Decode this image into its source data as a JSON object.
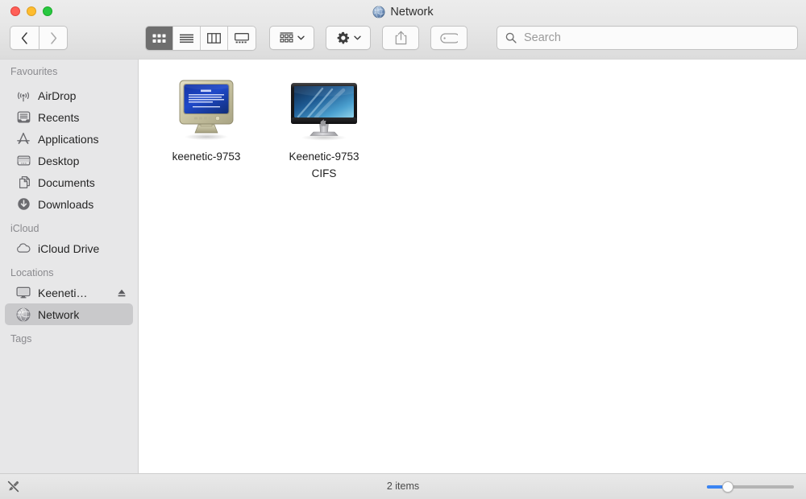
{
  "window": {
    "title": "Network",
    "title_icon": "globe-icon",
    "traffic_lights": [
      {
        "name": "close",
        "color": "#ff5f57"
      },
      {
        "name": "minimise",
        "color": "#febc2e"
      },
      {
        "name": "zoom",
        "color": "#28c840"
      }
    ]
  },
  "toolbar": {
    "back_icon": "chevron-left-icon",
    "forward_icon": "chevron-right-icon",
    "view_modes": [
      {
        "name": "icon-view",
        "icon": "grid-icon",
        "active": true
      },
      {
        "name": "list-view",
        "icon": "list-icon",
        "active": false
      },
      {
        "name": "column-view",
        "icon": "columns-icon",
        "active": false
      },
      {
        "name": "gallery-view",
        "icon": "gallery-icon",
        "active": false
      }
    ],
    "group_by": {
      "name": "group-by-button",
      "icon": "group-icon",
      "caret": "chevron-down-icon"
    },
    "action": {
      "name": "action-button",
      "icon": "gear-icon",
      "caret": "chevron-down-icon"
    },
    "share": {
      "name": "share-button",
      "icon": "share-icon"
    },
    "tag": {
      "name": "tag-button",
      "icon": "tag-icon"
    }
  },
  "search": {
    "placeholder": "Search",
    "value": "",
    "icon": "search-icon"
  },
  "sidebar": {
    "sections": [
      {
        "label": "Favourites",
        "items": [
          {
            "label": "AirDrop",
            "icon": "airdrop-icon",
            "selected": false
          },
          {
            "label": "Recents",
            "icon": "recents-icon",
            "selected": false
          },
          {
            "label": "Applications",
            "icon": "applications-icon",
            "selected": false
          },
          {
            "label": "Desktop",
            "icon": "desktop-icon",
            "selected": false
          },
          {
            "label": "Documents",
            "icon": "documents-icon",
            "selected": false
          },
          {
            "label": "Downloads",
            "icon": "downloads-icon",
            "selected": false
          }
        ]
      },
      {
        "label": "iCloud",
        "items": [
          {
            "label": "iCloud Drive",
            "icon": "icloud-icon",
            "selected": false
          }
        ]
      },
      {
        "label": "Locations",
        "items": [
          {
            "label": "Keeneti…",
            "icon": "display-icon",
            "selected": false,
            "eject": true
          },
          {
            "label": "Network",
            "icon": "globe-icon",
            "selected": true
          }
        ]
      },
      {
        "label": "Tags",
        "items": []
      }
    ]
  },
  "main": {
    "items": [
      {
        "label": "keenetic-9753",
        "icon": "crt-monitor-icon"
      },
      {
        "label": "Keenetic-9753 CIFS",
        "icon": "cinema-display-icon"
      }
    ]
  },
  "status": {
    "item_count": "2 items",
    "readonly_icon": "pencil-slash-icon",
    "zoom_slider_value": 20
  }
}
